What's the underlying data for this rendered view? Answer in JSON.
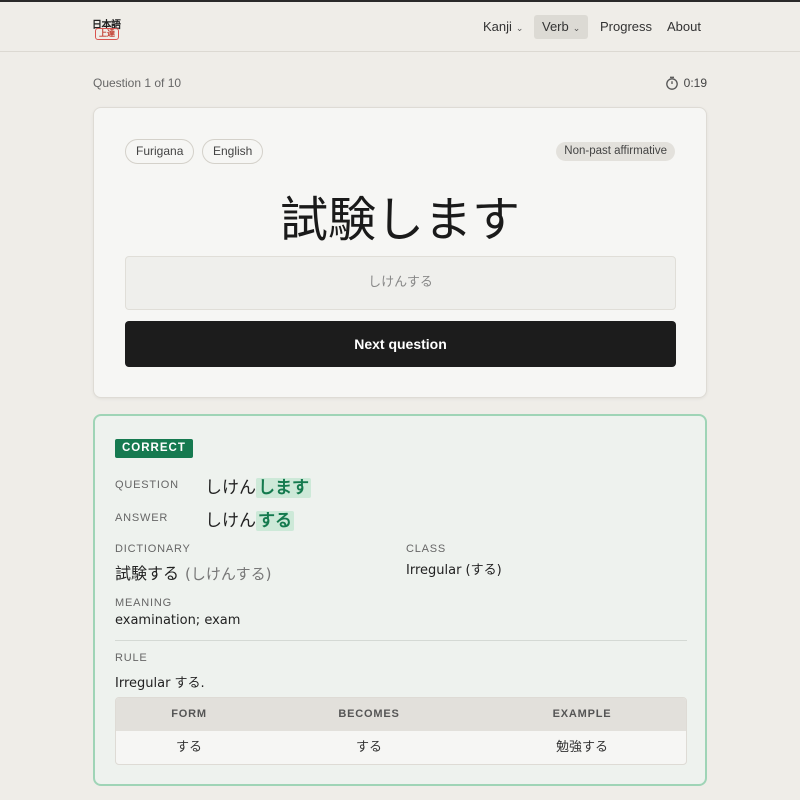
{
  "nav": {
    "logo_top": "日本語",
    "logo_bottom": "上達",
    "items": [
      {
        "label": "Kanji",
        "dropdown": true
      },
      {
        "label": "Verb",
        "dropdown": true,
        "active": true
      },
      {
        "label": "Progress"
      },
      {
        "label": "About"
      }
    ]
  },
  "quiz": {
    "counter": "Question 1 of 10",
    "timer": "0:19",
    "toggles": [
      "Furigana",
      "English"
    ],
    "form_badge": "Non-past affirmative",
    "prompt": "試験します",
    "answer_value": "しけんする",
    "next_label": "Next question"
  },
  "result": {
    "status": "CORRECT",
    "question_label": "QUESTION",
    "question_stem": "しけん",
    "question_ending": "します",
    "answer_label": "ANSWER",
    "answer_stem": "しけん",
    "answer_ending": "する",
    "dictionary_label": "DICTIONARY",
    "dictionary_word": "試験する",
    "dictionary_reading": "(しけんする)",
    "class_label": "CLASS",
    "class_value": "Irregular (する)",
    "meaning_label": "MEANING",
    "meaning_value": "examination; exam",
    "rule_label": "RULE",
    "rule_value": "Irregular する.",
    "table": {
      "headers": [
        "FORM",
        "BECOMES",
        "EXAMPLE"
      ],
      "rows": [
        [
          "する",
          "する",
          "勉強する"
        ]
      ]
    }
  },
  "colors": {
    "accent": "#167a50",
    "highlight_bg": "#cde9d8",
    "button_bg": "#1c1c1c",
    "result_border": "#9fd4b6"
  },
  "icons": {
    "timer": "stopwatch-icon",
    "dropdown": "chevron-down-icon"
  }
}
